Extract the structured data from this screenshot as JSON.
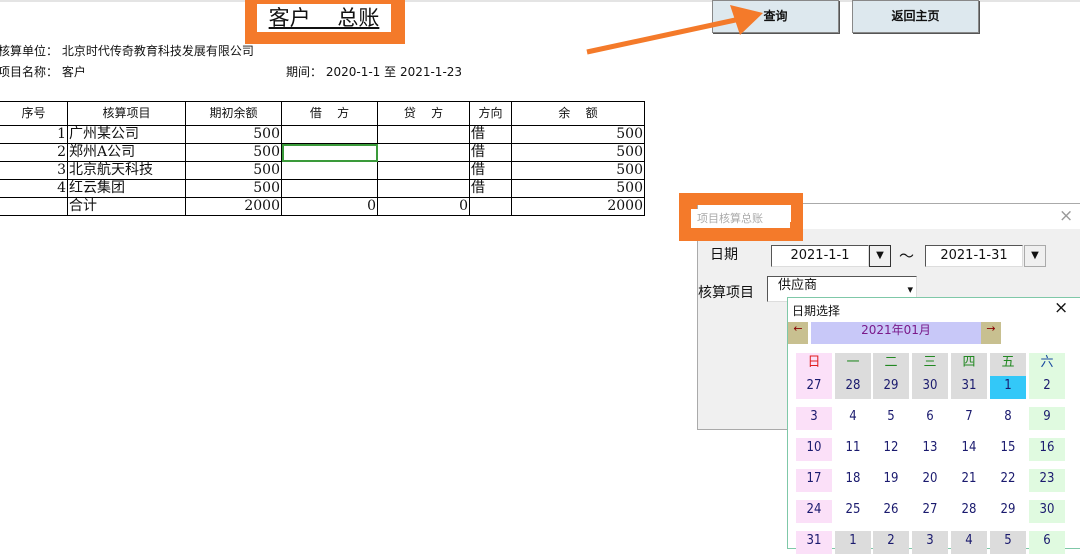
{
  "sheet": {
    "title": "客户    总账",
    "query_button": "查询",
    "home_button": "返回主页",
    "unit_label": "核算单位：",
    "unit_value": "北京时代传奇教育科技发展有限公司",
    "item_label": "项目名称：",
    "item_value": "客户",
    "period_label": "期间：",
    "period_value": "2020-1-1 至 2021-1-23"
  },
  "table": {
    "headers": [
      "序号",
      "核算项目",
      "期初余额",
      "借    方",
      "贷    方",
      "方向",
      "余    额"
    ],
    "rows": [
      [
        "1",
        "广州某公司",
        "500",
        "",
        "",
        "借",
        "500"
      ],
      [
        "2",
        "郑州A公司",
        "500",
        "",
        "",
        "借",
        "500"
      ],
      [
        "3",
        "北京航天科技",
        "500",
        "",
        "",
        "借",
        "500"
      ],
      [
        "4",
        "红云集团",
        "500",
        "",
        "",
        "借",
        "500"
      ]
    ],
    "total": [
      "",
      "合计",
      "2000",
      "0",
      "0",
      "",
      "2000"
    ]
  },
  "dialog": {
    "title": "项目核算总账",
    "close": "×",
    "date_label": "日期",
    "start_date": "2021-1-1",
    "tilde": "～",
    "end_date": "2021-1-31",
    "dropdown": "▼",
    "item_label": "核算项目",
    "item_value": "供应商",
    "combo_arrow": "▾"
  },
  "calendar": {
    "title": "日期选择",
    "close": "×",
    "prev": "←",
    "next": "→",
    "month": "2021年01月",
    "weekdays": [
      "日",
      "一",
      "二",
      "三",
      "四",
      "五",
      "六"
    ],
    "weeks": [
      [
        "27",
        "28",
        "29",
        "30",
        "31",
        "1",
        "2"
      ],
      [
        "3",
        "4",
        "5",
        "6",
        "7",
        "8",
        "9"
      ],
      [
        "10",
        "11",
        "12",
        "13",
        "14",
        "15",
        "16"
      ],
      [
        "17",
        "18",
        "19",
        "20",
        "21",
        "22",
        "23"
      ],
      [
        "24",
        "25",
        "26",
        "27",
        "28",
        "29",
        "30"
      ],
      [
        "31",
        "1",
        "2",
        "3",
        "4",
        "5",
        "6"
      ]
    ],
    "selected": "1",
    "colors": {
      "sunday": "#fbe0f8",
      "saturday": "#e0fae0",
      "gray": "#dcdcdc",
      "selected": "#33c8f8",
      "month_bar": "#c8c8f8",
      "nav": "#c8c090"
    }
  }
}
